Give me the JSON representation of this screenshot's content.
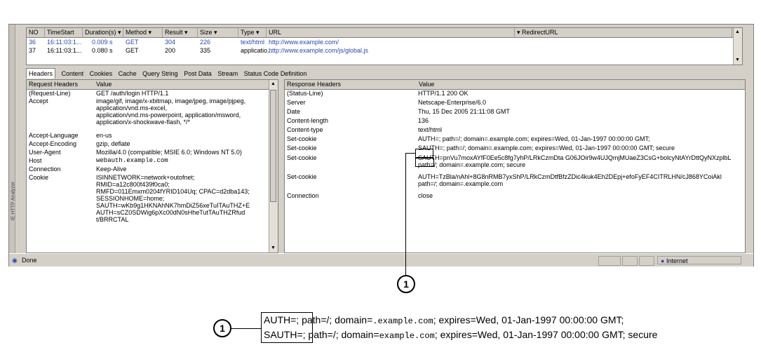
{
  "sessions": {
    "columns": [
      "NO",
      "TimeStart",
      "Duration(s)",
      "Method",
      "Result",
      "Size",
      "Type",
      "URL",
      "RedirectURL"
    ],
    "rows": [
      {
        "no": "36",
        "time": "16:11:03:1...",
        "duration": "0.009 s",
        "method": "GET",
        "result": "304",
        "size": "226",
        "type": "text/html",
        "url": "http://www.example.com/"
      },
      {
        "no": "37",
        "time": "16:11:03:1...",
        "duration": "0.080 s",
        "method": "GET",
        "result": "200",
        "size": "335",
        "type": "applicatio...",
        "url": "http://www.example.com/js/global.js"
      }
    ]
  },
  "tabs": [
    "Headers",
    "Content",
    "Cookies",
    "Cache",
    "Query String",
    "Post Data",
    "Stream",
    "Status Code Definition"
  ],
  "request": {
    "col1": "Request Headers",
    "col2": "Value",
    "rows": [
      {
        "k": "(Request-Line)",
        "v": "GET /auth/login HTTP/1.1"
      },
      {
        "k": "Accept",
        "v": "image/gif, image/x-xbitmap, image/jpeg, image/pjpeg,\napplication/vnd.ms-excel,\napplication/vnd.ms-powerpoint, application/msword,\napplication/x-shockwave-flash, */*"
      },
      {
        "k": "Accept-Language",
        "v": "en-us"
      },
      {
        "k": "Accept-Encoding",
        "v": "gzip, deflate"
      },
      {
        "k": "User-Agent",
        "v": "Mozilla/4.0 (compatible; MSIE 6.0; Windows NT 5.0)"
      },
      {
        "k": "Host",
        "v": "webauth.example.com"
      },
      {
        "k": "Connection",
        "v": "Keep-Alive"
      },
      {
        "k": "Cookie",
        "v": "ISINNETWORK=network+outofnet;\nRMID=a12c800f439f0ca0;\nRMFD=011Emxm0204fYRID104Uq; CPAC=d2dba143;\nSESSIONHOME=home;\nSAUTH=wKb9g1HKNAhNK7hmDiZ56xeTuITAuTHZ+E\nAUTH=sCZ0SDWig6pXc00dN0sHheTutTAuTHZRfud\nt/BRRCTAL"
      }
    ]
  },
  "response": {
    "col1": "Response Headers",
    "col2": "Value",
    "rows": [
      {
        "k": "(Status-Line)",
        "v": "HTTP/1.1 200 OK"
      },
      {
        "k": "Server",
        "v": "Netscape-Enterprise/6.0"
      },
      {
        "k": "Date",
        "v": "Thu, 15 Dec 2005 21:11:08 GMT"
      },
      {
        "k": "Content-length",
        "v": "136"
      },
      {
        "k": "Content-type",
        "v": "text/html"
      },
      {
        "k": "Set-cookie",
        "v": "AUTH=; path=/; domain=.example.com; expires=Wed, 01-Jan-1997 00:00:00 GMT;"
      },
      {
        "k": "Set-cookie",
        "v": "SAUTH=; path=/; domain=.example.com; expires=Wed, 01-Jan-1997 00:00:00 GMT; secure"
      },
      {
        "k": "Set-cookie",
        "v": "SAUTH=pnVu7moxAYfF0Ee5c8fg7yhP/LRkCzmDta G06JOir9w4UJQmjMUaeZ3CsG+bolcyNtAYrDttQyNXzplbL\npath=/; domain=.example.com; secure"
      },
      {
        "k": "Set-cookie",
        "v": "AUTH=TzBla/nAhl+8G8nRMB7yxShP/LRkCzmDtfBfzZDic4kuk4Eh2DEpj+efoFyEF4CITRLHN/cJ868YCoiAkl\npath=/; domain=.example.com"
      },
      {
        "k": "Connection",
        "v": "close"
      }
    ]
  },
  "sidebar_label": "IE HTTP Analyzer",
  "status": {
    "left": "Done",
    "zone": "Internet"
  },
  "callout": {
    "number": "1"
  },
  "zoom": {
    "line1": {
      "a": "AUTH=",
      "b": "; path=/; domain=",
      "c": ".example.com",
      "d": "; expires=Wed, 01-Jan-1997 00:00:00 GMT;"
    },
    "line2": {
      "a": "SAUTH=",
      "b": "; path=/; domain=",
      "c": "example.com",
      "d": "; expires=Wed, 01-Jan-1997 00:00:00 GMT; secure"
    }
  }
}
